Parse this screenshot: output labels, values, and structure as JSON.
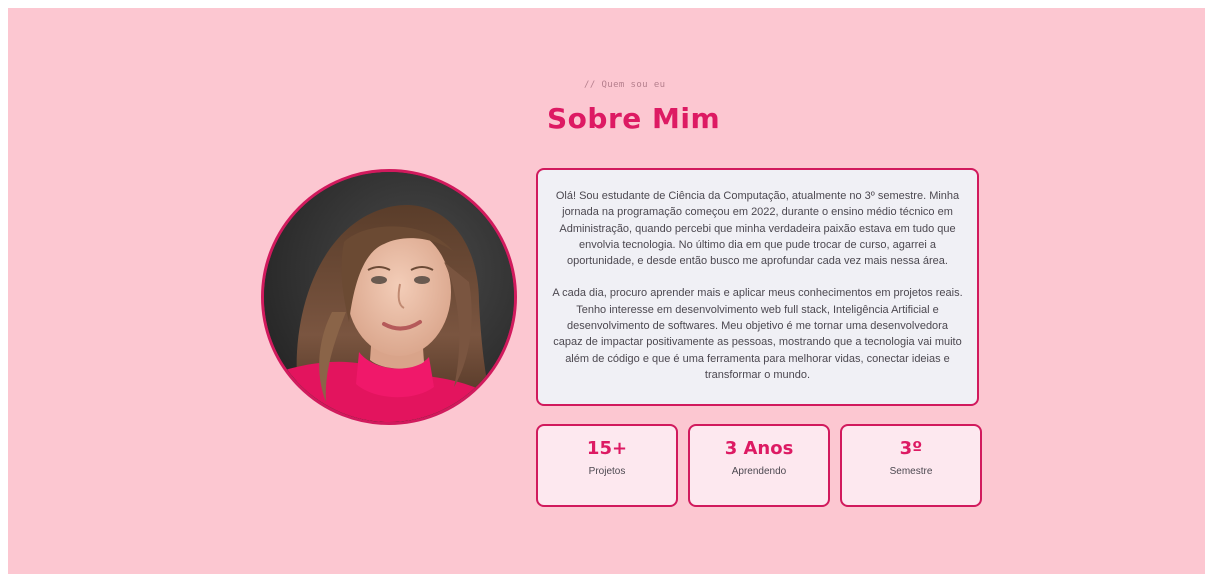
{
  "section": {
    "eyebrow": "// Quem sou eu",
    "title": "Sobre Mim"
  },
  "profile": {
    "photo_description": "profile-photo"
  },
  "bio": {
    "paragraphs": [
      "Olá! Sou estudante de Ciência da Computação, atualmente no 3º semestre. Minha jornada na programação começou em 2022, durante o ensino médio técnico em Administração, quando percebi que minha verdadeira paixão estava em tudo que envolvia tecnologia. No último dia em que pude trocar de curso, agarrei a oportunidade, e desde então busco me aprofundar cada vez mais nessa área.",
      "A cada dia, procuro aprender mais e aplicar meus conhecimentos em projetos reais. Tenho interesse em desenvolvimento web full stack, Inteligência Artificial e desenvolvimento de softwares. Meu objetivo é me tornar uma desenvolvedora capaz de impactar positivamente as pessoas, mostrando que a tecnologia vai muito além de código e que é uma ferramenta para melhorar vidas, conectar ideias e transformar o mundo."
    ]
  },
  "stats": [
    {
      "value": "15+",
      "label": "Projetos"
    },
    {
      "value": "3 Anos",
      "label": "Aprendendo"
    },
    {
      "value": "3º",
      "label": "Semestre"
    }
  ],
  "colors": {
    "background": "#fcc7d1",
    "accent": "#dd1a63",
    "border": "#d11a5d",
    "card": "#f0f0f5",
    "stat_card": "#fde8ef"
  }
}
